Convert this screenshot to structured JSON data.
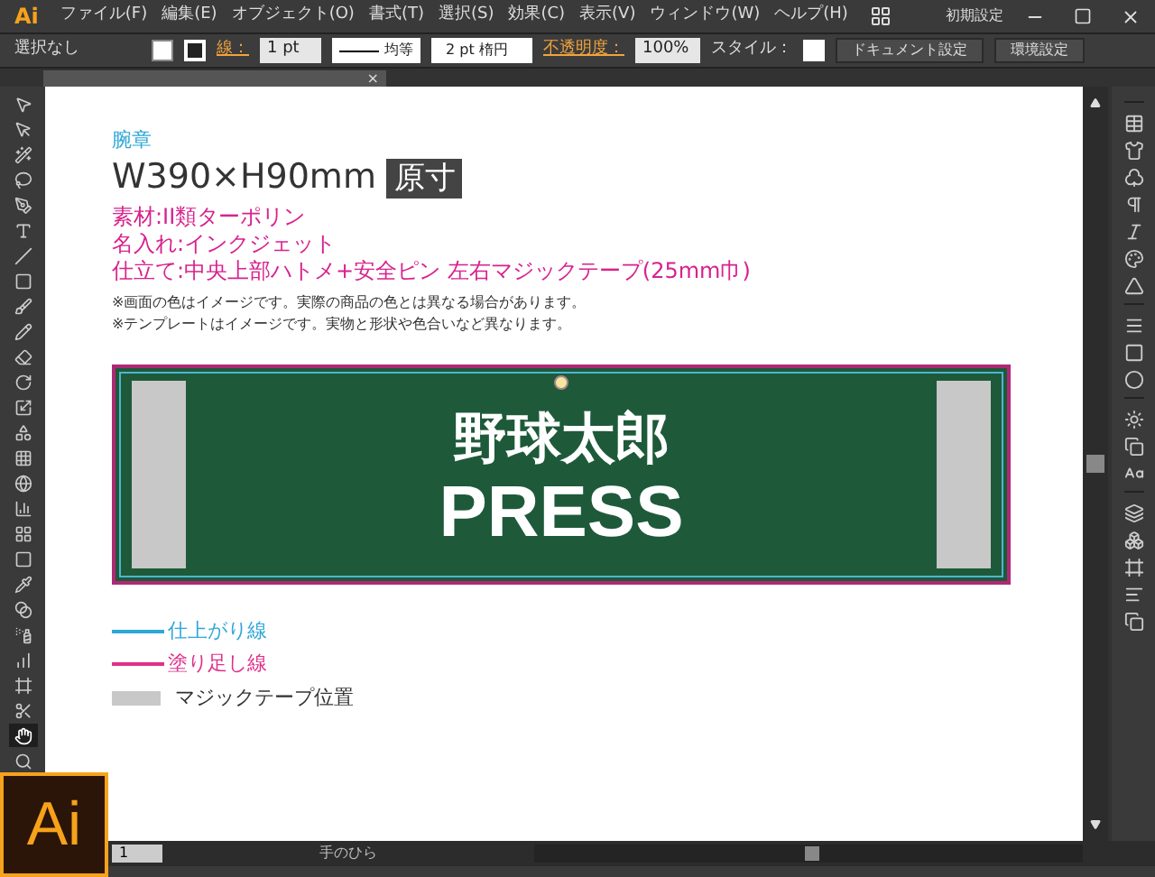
{
  "app_logo": "Ai",
  "app_badge_logo": "Ai",
  "menu": [
    "ファイル(F)",
    "編集(E)",
    "オブジェクト(O)",
    "書式(T)",
    "選択(S)",
    "効果(C)",
    "表示(V)",
    "ウィンドウ(W)",
    "ヘルプ(H)"
  ],
  "workspace": "初期設定",
  "control_bar": {
    "selection": "選択なし",
    "stroke_label": "線：",
    "stroke_weight": "1 pt",
    "profile": "均等",
    "brush": "2 pt 楕円",
    "opacity_label": "不透明度：",
    "opacity": "100%",
    "style_label": "スタイル：",
    "buttons": [
      "ドキュメント設定",
      "環境設定"
    ]
  },
  "tab": {
    "close": "×"
  },
  "tools": [
    {
      "selected": false
    },
    {
      "selected": false
    },
    {
      "selected": false
    },
    {
      "selected": false
    },
    {
      "selected": false
    },
    {
      "selected": false
    },
    {
      "selected": false
    },
    {
      "selected": false
    },
    {
      "selected": false
    },
    {
      "selected": false
    },
    {
      "selected": false
    },
    {
      "selected": false
    },
    {
      "selected": false
    },
    {
      "selected": false
    },
    {
      "selected": false
    },
    {
      "selected": false
    },
    {
      "selected": false
    },
    {
      "selected": false
    },
    {
      "selected": false
    },
    {
      "selected": false
    },
    {
      "selected": false
    },
    {
      "selected": false
    },
    {
      "selected": false
    },
    {
      "selected": false
    },
    {
      "selected": false
    },
    {
      "selected": true
    },
    {
      "selected": false
    }
  ],
  "document": {
    "category": "腕章",
    "size": "W390×H90mm",
    "scale_badge": "原寸",
    "specs": [
      "素材:II類ターポリン",
      "名入れ:インクジェット",
      "仕立て:中央上部ハトメ+安全ピン 左右マジックテープ(25mm巾)"
    ],
    "notes": [
      "※画面の色はイメージです。実際の商品の色とは異なる場合があります。",
      "※テンプレートはイメージです。実物と形状や色合いなど異なります。"
    ],
    "armband": {
      "line1": "野球太郎",
      "line2": "PRESS"
    },
    "legend": [
      {
        "kind": "line",
        "color": "#2ea7d8",
        "label": "仕上がり線"
      },
      {
        "kind": "line",
        "color": "#e0308c",
        "label": "塗り足し線"
      },
      {
        "kind": "swatch",
        "color": "#c8c8c8",
        "label": "マジックテープ位置"
      }
    ]
  },
  "status_bar": {
    "page": "1",
    "tool": "手のひら"
  }
}
